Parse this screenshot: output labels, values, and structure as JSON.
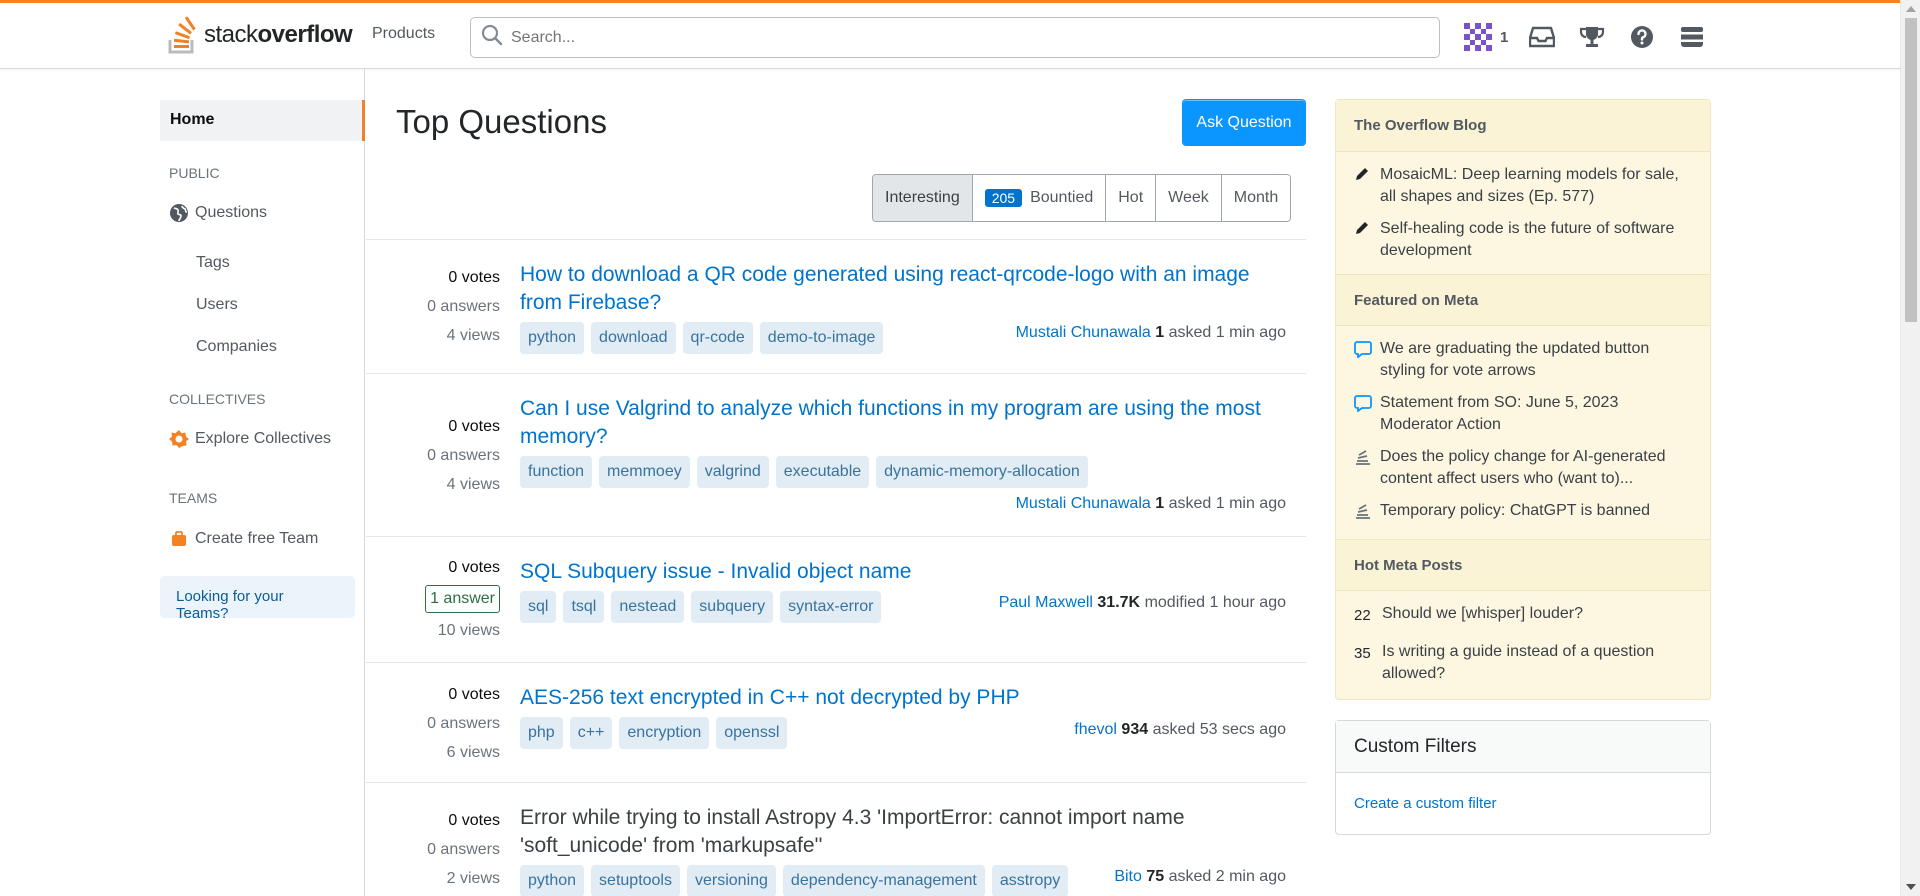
{
  "header": {
    "logo_plain": "stack",
    "logo_bold": "overflow",
    "products_label": "Products",
    "search_placeholder": "Search...",
    "reputation": "1",
    "icons": [
      "avatar-identicon",
      "inbox-icon",
      "achievements-icon",
      "help-icon",
      "site-switcher-icon"
    ]
  },
  "leftnav": {
    "home": "Home",
    "public_label": "PUBLIC",
    "questions": "Questions",
    "tags": "Tags",
    "users": "Users",
    "companies": "Companies",
    "collectives_label": "COLLECTIVES",
    "explore_collectives": "Explore Collectives",
    "teams_label": "TEAMS",
    "create_team": "Create free Team",
    "looking_teams": "Looking for your Teams?"
  },
  "main": {
    "title": "Top Questions",
    "ask_button": "Ask Question",
    "filters": [
      {
        "label": "Interesting",
        "active": true
      },
      {
        "label": "Bountied",
        "badge": "205"
      },
      {
        "label": "Hot"
      },
      {
        "label": "Week"
      },
      {
        "label": "Month"
      }
    ],
    "questions": [
      {
        "votes": "0 votes",
        "answers": "0 answers",
        "views": "4 views",
        "title": "How to download a QR code generated using react-qrcode-logo with an image from Firebase?",
        "tags": [
          "python",
          "download",
          "qr-code",
          "demo-to-image"
        ],
        "user": "Mustali Chunawala",
        "rep": "1",
        "action": "asked 1 min ago"
      },
      {
        "votes": "0 votes",
        "answers": "0 answers",
        "views": "4 views",
        "title": "Can I use Valgrind to analyze which functions in my program are using the most memory?",
        "tags": [
          "function",
          "memmoey",
          "valgrind",
          "executable",
          "dynamic-memory-allocation"
        ],
        "user": "Mustali Chunawala",
        "rep": "1",
        "action": "asked 1 min ago"
      },
      {
        "votes": "0 votes",
        "answers": "1 answer",
        "views": "10 views",
        "title": "SQL Subquery issue - Invalid object name",
        "tags": [
          "sql",
          "tsql",
          "nestead",
          "subquery",
          "syntax-error"
        ],
        "user": "Paul Maxwell",
        "rep": "31.7K",
        "action": "modified 1 hour ago"
      },
      {
        "votes": "0 votes",
        "answers": "0 answers",
        "views": "6 views",
        "title": "AES-256 text encrypted in C++ not decrypted by PHP",
        "tags": [
          "php",
          "c++",
          "encryption",
          "openssl"
        ],
        "user": "fhevol",
        "rep": "934",
        "action": "asked 53 secs ago"
      },
      {
        "votes": "0 votes",
        "answers": "0 answers",
        "views": "2 views",
        "title": "Error while trying to install Astropy 4.3 'ImportError: cannot import name 'soft_unicode' from 'markupsafe''",
        "tags": [
          "python",
          "setuptools",
          "versioning",
          "dependency-management",
          "asstropy"
        ],
        "user": "Bito",
        "rep": "75",
        "action": "asked 2 min ago"
      }
    ]
  },
  "sidebar": {
    "blog_header": "The Overflow Blog",
    "blog_items": [
      "MosaicML: Deep learning models for sale, all shapes and sizes (Ep. 577)",
      "Self-healing code is the future of software development"
    ],
    "meta_header": "Featured on Meta",
    "meta_items": [
      "We are graduating the updated button styling for vote arrows",
      "Statement from SO: June 5, 2023 Moderator Action",
      "Does the policy change for AI-generated content affect users who (want to)...",
      "Temporary policy: ChatGPT is banned"
    ],
    "hot_header": "Hot Meta Posts",
    "hot_items": [
      {
        "count": "22",
        "title": "Should we [whisper] louder?"
      },
      {
        "count": "35",
        "title": "Is writing a guide instead of a question allowed?"
      }
    ],
    "custom_header": "Custom Filters",
    "custom_link": "Create a custom filter"
  },
  "colors": {
    "accent": "#f48225",
    "link": "#0074cc",
    "button": "#0a95ff",
    "tag_bg": "#e1ecf4",
    "blog_bg": "#fdf7e2"
  }
}
